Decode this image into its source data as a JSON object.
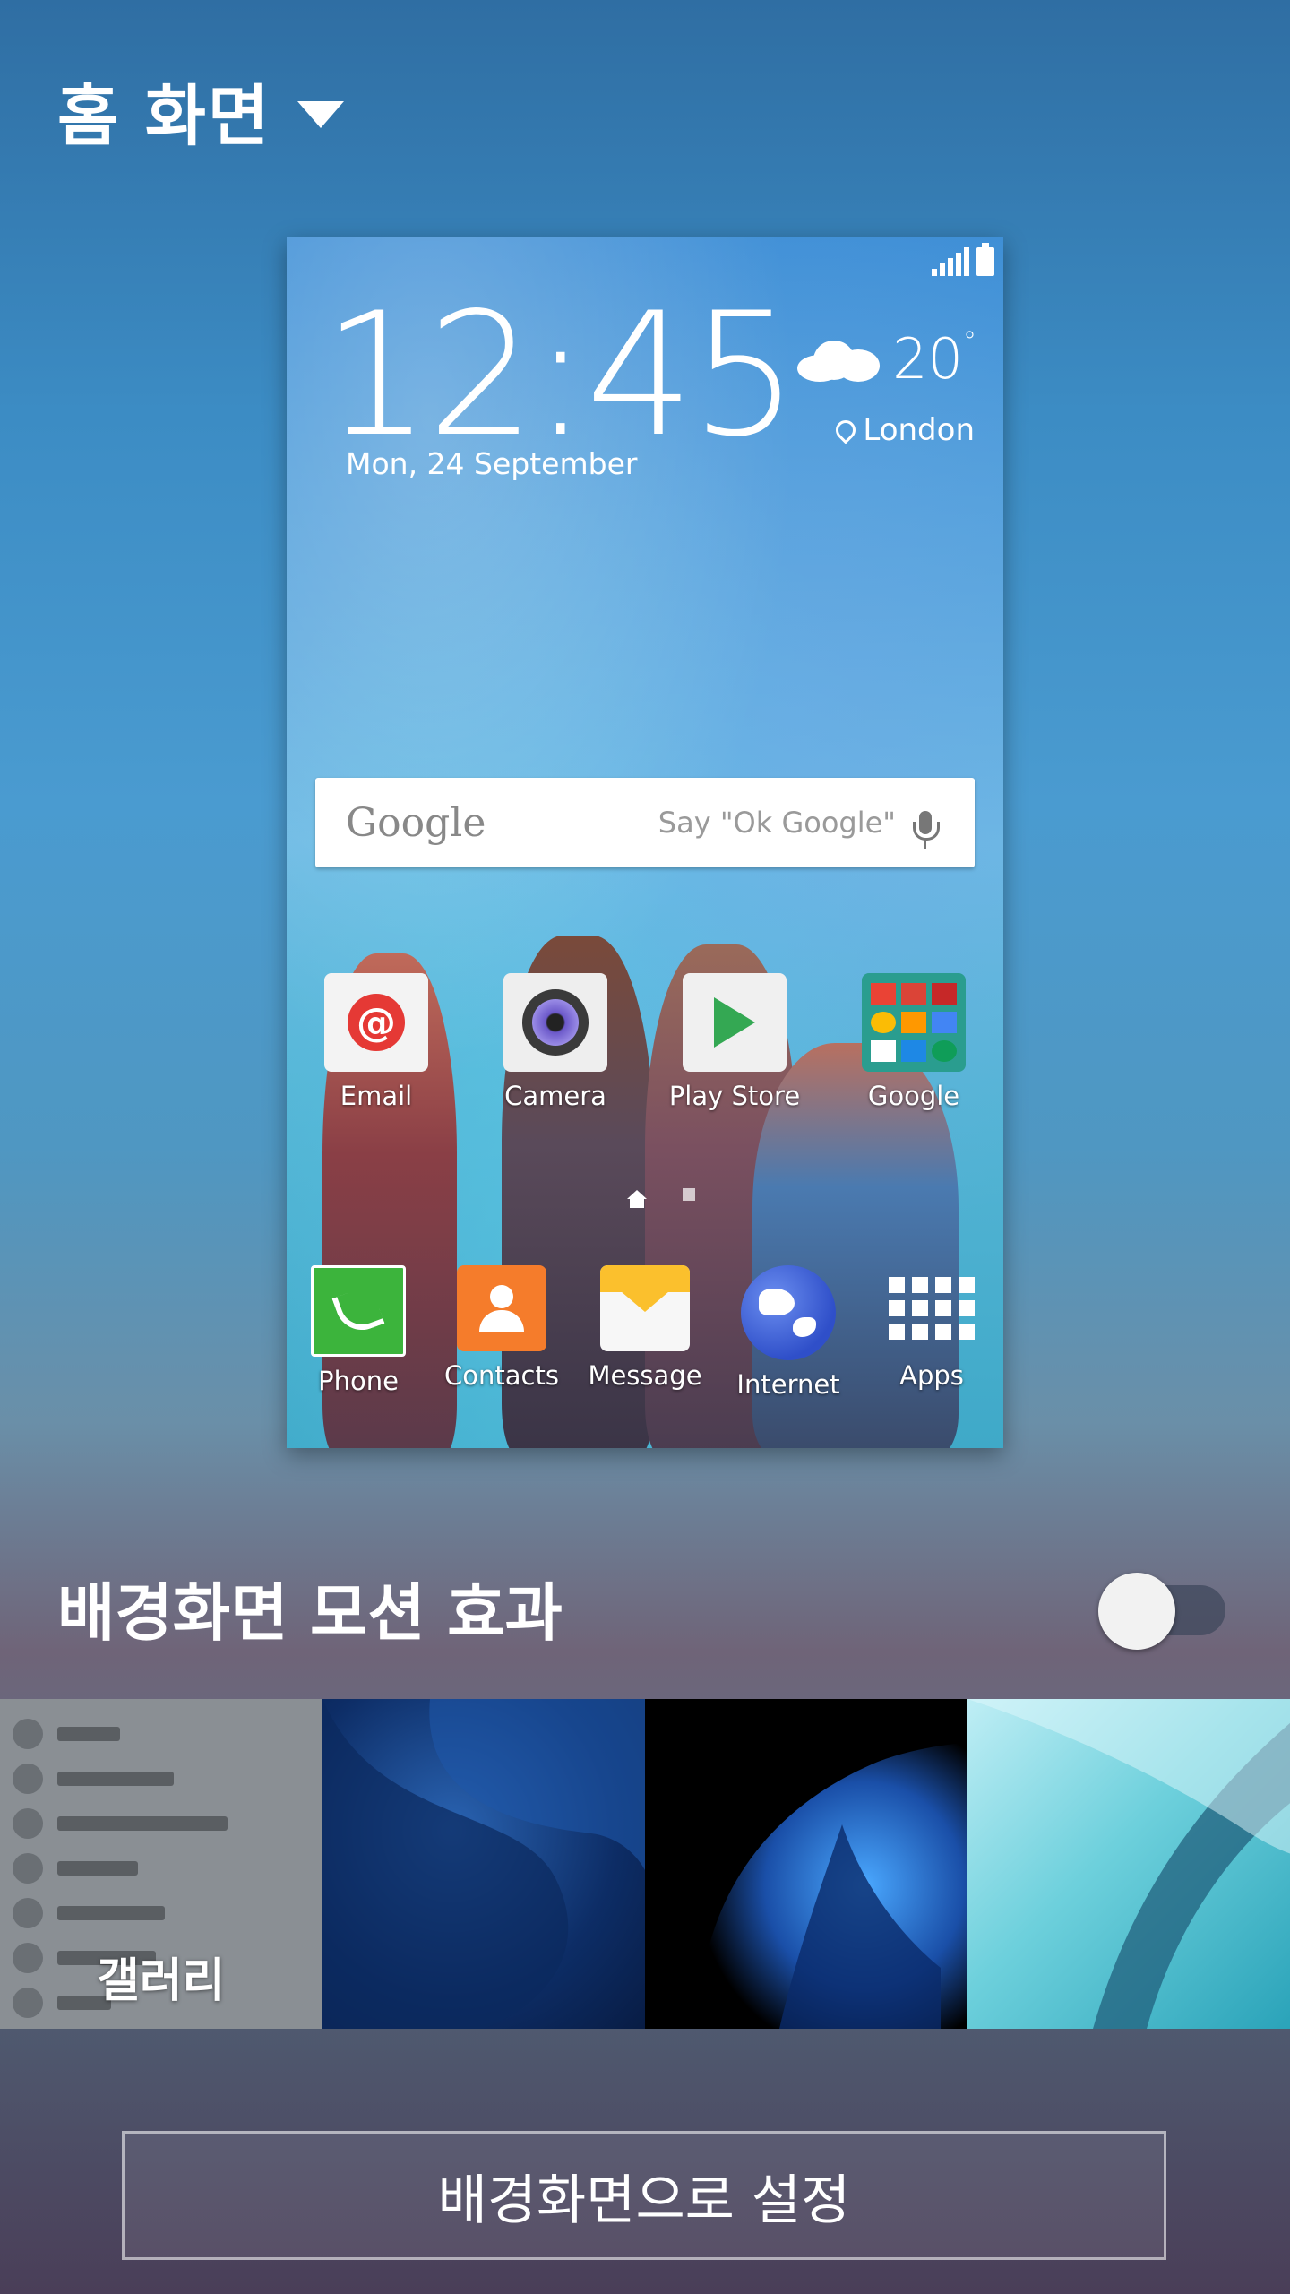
{
  "header": {
    "title": "홈 화면"
  },
  "preview": {
    "clock": "12:45",
    "date": "Mon, 24 September",
    "weather": {
      "temperature": "20",
      "unit": "°",
      "city": "London"
    },
    "search": {
      "brand": "Google",
      "hint": "Say \"Ok Google\""
    },
    "apps_row1": [
      {
        "label": "Email",
        "icon": "email-icon"
      },
      {
        "label": "Camera",
        "icon": "camera-icon"
      },
      {
        "label": "Play Store",
        "icon": "play-store-icon"
      },
      {
        "label": "Google",
        "icon": "google-folder-icon"
      }
    ],
    "apps_row2": [
      {
        "label": "Phone",
        "icon": "phone-icon"
      },
      {
        "label": "Contacts",
        "icon": "contacts-icon"
      },
      {
        "label": "Message",
        "icon": "message-icon"
      },
      {
        "label": "Internet",
        "icon": "internet-globe-icon"
      },
      {
        "label": "Apps",
        "icon": "apps-grid-icon"
      }
    ]
  },
  "motion_effect": {
    "label": "배경화면 모션 효과",
    "enabled": false
  },
  "wallpapers": {
    "gallery_label": "갤러리"
  },
  "set_button": {
    "label": "배경화면으로 설정"
  }
}
